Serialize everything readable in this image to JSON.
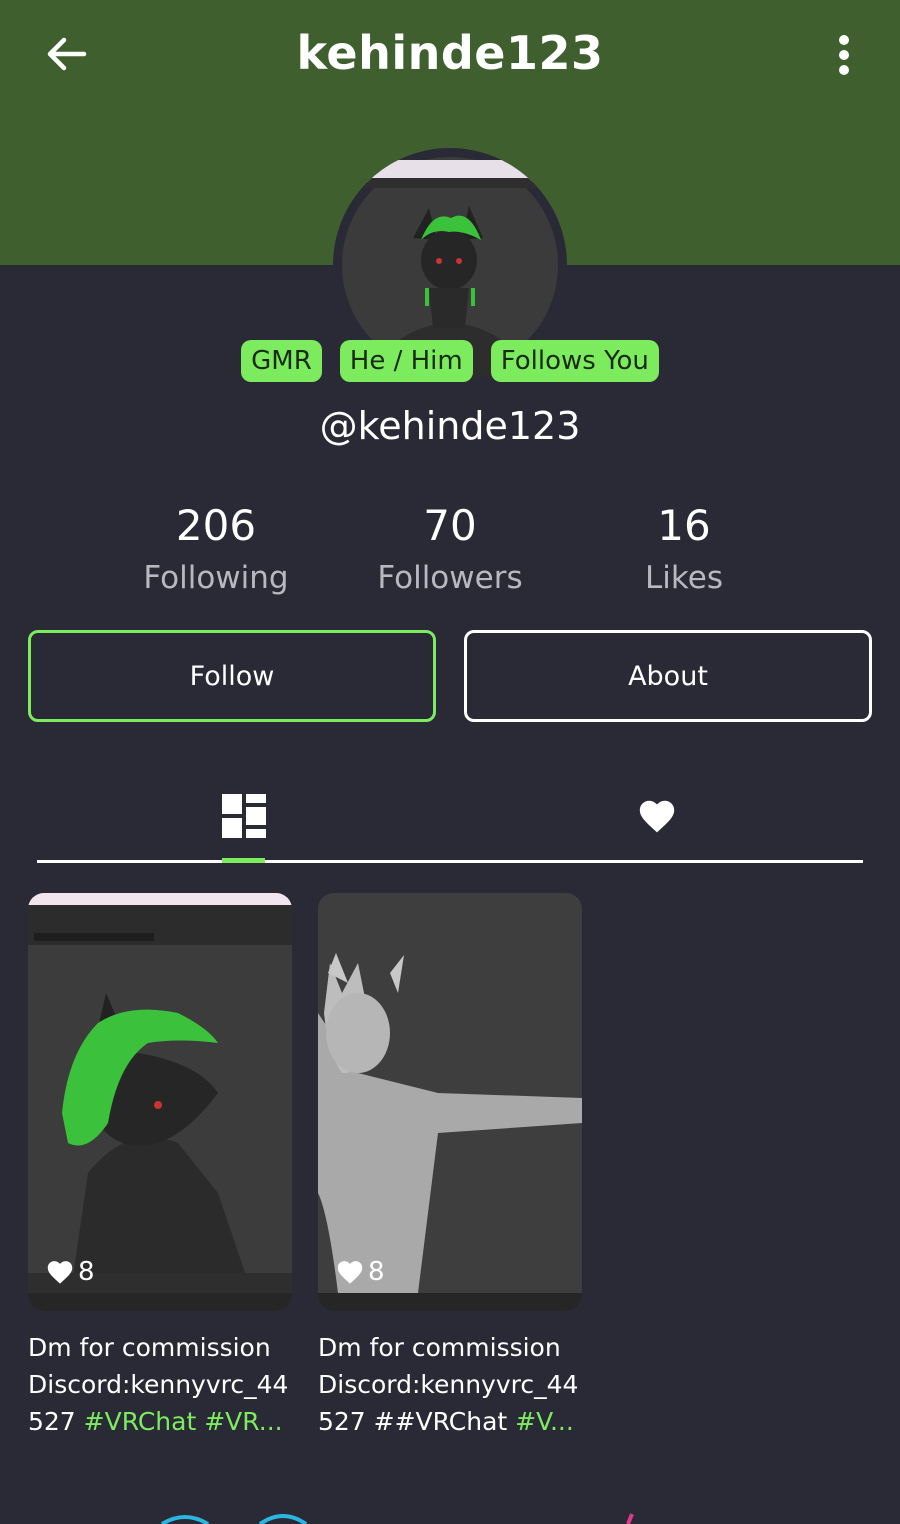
{
  "header": {
    "title": "kehinde123"
  },
  "profile": {
    "badges": [
      "GMR",
      "He / Him",
      "Follows You"
    ],
    "handle": "@kehinde123",
    "avatar_image": "wolf avatar with green hair"
  },
  "stats": [
    {
      "value": "206",
      "label": "Following"
    },
    {
      "value": "70",
      "label": "Followers"
    },
    {
      "value": "16",
      "label": "Likes"
    }
  ],
  "actions": {
    "follow_label": "Follow",
    "about_label": "About"
  },
  "tabs": [
    {
      "icon": "grid-icon",
      "active": true
    },
    {
      "icon": "heart-icon",
      "active": false
    }
  ],
  "posts": [
    {
      "likes": "8",
      "caption_line1": "Dm for commission",
      "caption_line2": "Discord:kennyvrc_44",
      "caption_line3_text": "527 ",
      "caption_line3_tags": "#VRChat #VR..."
    },
    {
      "likes": "8",
      "caption_line1": "Dm for commission",
      "caption_line2": "Discord:kennyvrc_44",
      "caption_line3_text": "527 ##VRChat ",
      "caption_line3_tags": "#V..."
    }
  ],
  "colors": {
    "header_bg": "#3f5f2f",
    "accent": "#7deb5e",
    "page_bg": "#2a2a36"
  }
}
